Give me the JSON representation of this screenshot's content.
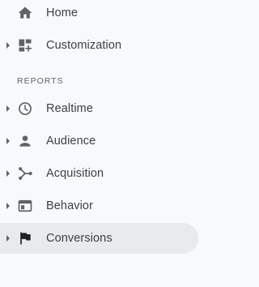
{
  "nav": {
    "top_items": [
      {
        "label": "Home",
        "icon": "home-icon",
        "expandable": false
      },
      {
        "label": "Customization",
        "icon": "dashboard-add-icon",
        "expandable": true
      }
    ],
    "reports_header": "REPORTS",
    "report_items": [
      {
        "label": "Realtime",
        "icon": "clock-icon",
        "expandable": true
      },
      {
        "label": "Audience",
        "icon": "person-icon",
        "expandable": true
      },
      {
        "label": "Acquisition",
        "icon": "acquisition-icon",
        "expandable": true
      },
      {
        "label": "Behavior",
        "icon": "behavior-icon",
        "expandable": true
      },
      {
        "label": "Conversions",
        "icon": "flag-icon",
        "expandable": true,
        "selected": true
      }
    ]
  },
  "colors": {
    "background": "#f8f9fa",
    "selected_background": "#e8eaed",
    "icon": "#5f6368",
    "text": "#3c4043"
  }
}
